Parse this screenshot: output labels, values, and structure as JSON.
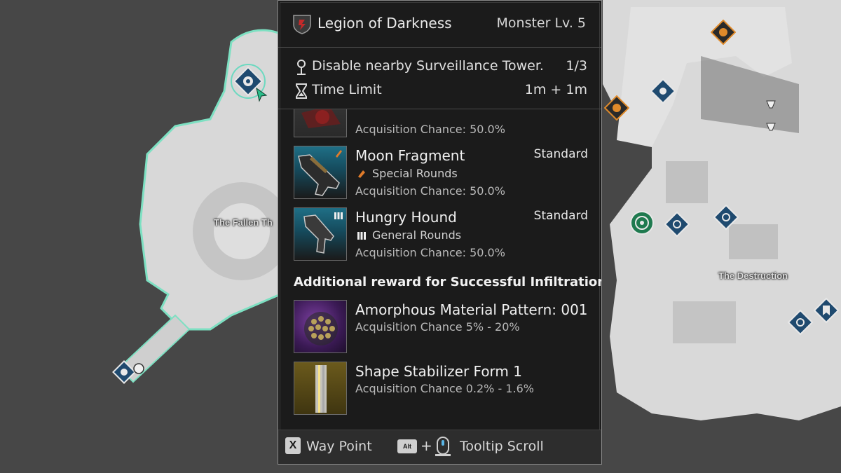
{
  "map": {
    "labels": {
      "fallen": "The Fallen Th",
      "destruction": "The Destruction"
    },
    "markers": [
      "waypoint-marker-icon",
      "infiltration-marker-icon",
      "monster-marker-icon",
      "mission-marker-icon",
      "bookmark-marker-icon",
      "orange-objective-icon",
      "green-objective-icon",
      "tower-icon"
    ]
  },
  "tooltip": {
    "faction": "Legion of Darkness",
    "monster_level": "Monster Lv. 5",
    "mission": {
      "objective": "Disable nearby Surveillance Tower.",
      "progress": "1/3",
      "time_label": "Time Limit",
      "time_value": "1m + 1m"
    },
    "rewards": [
      {
        "name": "Moon Fragment",
        "tier": "Standard",
        "ammo": "Special Rounds",
        "chance": "Acquisition Chance: 50.0%"
      },
      {
        "name": "Hungry Hound",
        "tier": "Standard",
        "ammo": "General Rounds",
        "chance": "Acquisition Chance: 50.0%"
      }
    ],
    "partial_reward_chance": "Acquisition Chance: 50.0%",
    "additional_header": "Additional reward for Successful Infiltration.",
    "additional": [
      {
        "name": "Amorphous Material Pattern: 001",
        "chance": "Acquisition Chance 5% - 20%"
      },
      {
        "name": "Shape Stabilizer Form 1",
        "chance": "Acquisition Chance 0.2% - 1.6%"
      }
    ],
    "footer": {
      "waypoint_key": "X",
      "waypoint_label": "Way Point",
      "alt_key": "Alt",
      "plus": "+",
      "scroll_label": "Tooltip Scroll"
    }
  },
  "colors": {
    "tooltip_bg": "#1b1b1b",
    "accent_blue": "#1f6f9a",
    "accent_orange": "#e07b2a",
    "accent_green": "#2aa86a"
  }
}
